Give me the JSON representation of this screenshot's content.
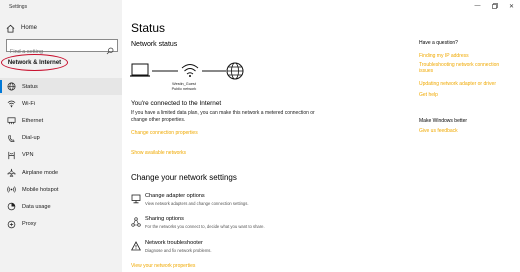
{
  "window": {
    "title": "Settings"
  },
  "sidebar": {
    "home_label": "Home",
    "search_placeholder": "Find a setting",
    "section_title": "Network & Internet",
    "items": [
      {
        "label": "Status",
        "icon": "globe-icon",
        "active": true
      },
      {
        "label": "Wi-Fi",
        "icon": "wifi-icon"
      },
      {
        "label": "Ethernet",
        "icon": "ethernet-icon"
      },
      {
        "label": "Dial-up",
        "icon": "dialup-icon"
      },
      {
        "label": "VPN",
        "icon": "vpn-icon"
      },
      {
        "label": "Airplane mode",
        "icon": "airplane-icon"
      },
      {
        "label": "Mobile hotspot",
        "icon": "hotspot-icon"
      },
      {
        "label": "Data usage",
        "icon": "data-usage-icon"
      },
      {
        "label": "Proxy",
        "icon": "proxy-icon"
      }
    ]
  },
  "main": {
    "title": "Status",
    "network_status_heading": "Network status",
    "network_name": "Westin_Guest",
    "network_type": "Public network",
    "connected_text": "You're connected to the Internet",
    "limited_text": "If you have a limited data plan, you can make this network a metered connection or change other properties.",
    "change_connection_properties": "Change connection properties",
    "show_available_networks": "Show available networks",
    "change_settings_heading": "Change your network settings",
    "options": [
      {
        "title": "Change adapter options",
        "desc": "View network adapters and change connection settings.",
        "icon": "adapter-icon"
      },
      {
        "title": "Sharing options",
        "desc": "For the networks you connect to, decide what you want to share.",
        "icon": "sharing-icon"
      },
      {
        "title": "Network troubleshooter",
        "desc": "Diagnose and fix network problems.",
        "icon": "warning-icon"
      }
    ],
    "view_network_properties": "View your network properties"
  },
  "right": {
    "question_heading": "Have a question?",
    "links": [
      "Finding my IP address",
      "Troubleshooting network connection issues",
      "Updating network adapter or driver",
      "Get help"
    ],
    "better_heading": "Make Windows better",
    "feedback_link": "Give us feedback"
  },
  "colors": {
    "accent": "#0078d7",
    "link_orange": "#f0a900",
    "highlight_ring": "#c8102e",
    "sidebar_bg": "#f2f2f2"
  }
}
